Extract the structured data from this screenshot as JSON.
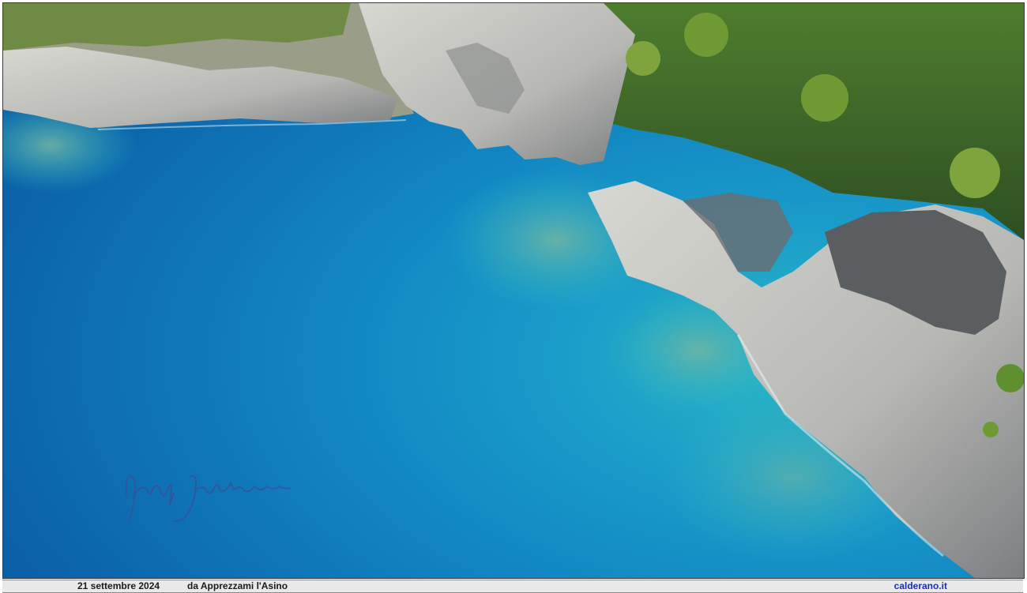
{
  "photo": {
    "subject": "aerial-coastline",
    "colors": {
      "deep_sea": "#0b5fa6",
      "mid_sea": "#1185c2",
      "shallow_sea": "#2bb7c4",
      "reef": "#5fa9a0",
      "rock": "#c9c9c4",
      "rock_shadow": "#6d6f73",
      "vegetation": "#3f6b2a",
      "vegetation_light": "#7fa43e"
    }
  },
  "caption": {
    "date": "21 settembre 2024",
    "place": "da Apprezzami l'Asino",
    "site": "calderano.it"
  },
  "signature": {
    "icon": "handwritten-signature-watermark"
  }
}
